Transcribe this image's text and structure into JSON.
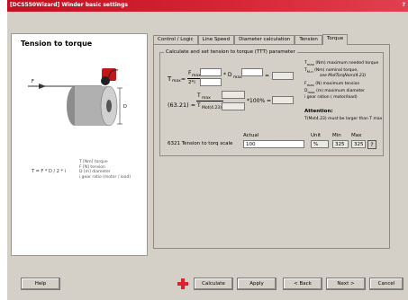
{
  "window": {
    "title": "[DCS550Wizard] Winder basic settings",
    "help_glyph": "?"
  },
  "left_panel": {
    "heading": "Tension to torque",
    "legend": [
      "T [Nm] torque",
      "F [N]  tension",
      "D [m]  diameter",
      "i      gear ratio (motor / load)"
    ],
    "formula": "T = F * D / 2 * i",
    "diagram_labels": {
      "force": "F",
      "diameter": "D"
    }
  },
  "tabs": [
    {
      "label": "Control / Logic",
      "active": false
    },
    {
      "label": "Line Speed",
      "active": false
    },
    {
      "label": "Diameter calculation",
      "active": false
    },
    {
      "label": "Tension",
      "active": false
    },
    {
      "label": "Torque",
      "active": true
    }
  ],
  "group": {
    "title": "Calculate and set tension to torque (TTT) parameter",
    "eq1": {
      "lhs": "T",
      "lhs_sub": "max",
      "numerator": "F",
      "numerator_sub": "max",
      "denominator": "2*i",
      "times": "* D",
      "times_sub": "max",
      "equals": "="
    },
    "eq2": {
      "lhs": "(63.21) =",
      "numerator": "T",
      "numerator_sub": "max",
      "denominator": "T",
      "denominator_sub": "Mot(4.23)",
      "tail": "*100% ="
    },
    "definitions": [
      {
        "sym": "T",
        "sub": "max",
        "unit": "(Nm)",
        "text": "maximum needed torque"
      },
      {
        "sym": "T",
        "sub": "M-n",
        "unit": "(Nm)",
        "text": "nominal torque,",
        "extra": "see MotTorqNom(4.23)"
      },
      {
        "sym": "F",
        "sub": "max",
        "unit": "(N)",
        "text": "maximum tension"
      },
      {
        "sym": "D",
        "sub": "max",
        "unit": "(m)",
        "text": "maximum diameter"
      },
      {
        "sym": "i",
        "sub": "",
        "unit": "",
        "text": "gear ration ( motor/load)"
      }
    ],
    "attention_title": "Attention:",
    "attention_text": "T(Mot4.23) must be larger than T max"
  },
  "param_table": {
    "headers": {
      "actual": "Actual",
      "unit": "Unit",
      "min": "Min",
      "max": "Max"
    },
    "row": {
      "name": "6321 Tension to torq scale",
      "actual": "100",
      "unit": "%",
      "min": "325",
      "max": "325",
      "help": "?"
    }
  },
  "buttons": {
    "help": "Help",
    "calculate": "Calculate",
    "apply": "Apply",
    "back": "< Back",
    "next": "Next >",
    "cancel": "Cancel"
  },
  "colors": {
    "titlebar": "#c81828",
    "background": "#d4d0c8",
    "calc_icon": "#e0202a"
  }
}
